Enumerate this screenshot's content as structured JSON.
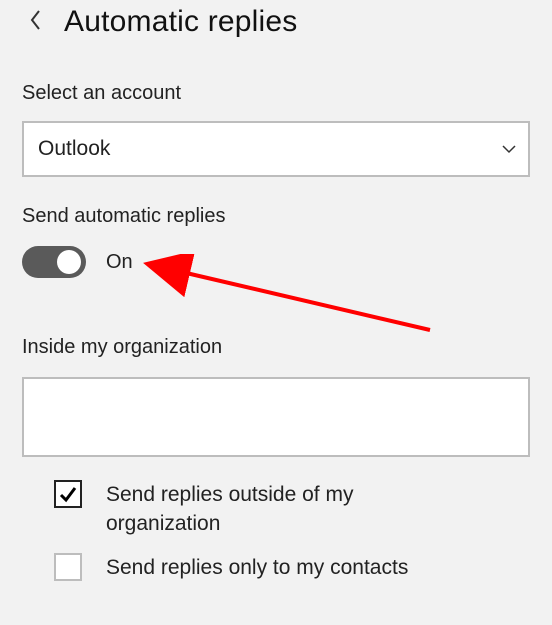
{
  "header": {
    "title": "Automatic replies"
  },
  "account": {
    "label": "Select an account",
    "selected": "Outlook"
  },
  "autoReply": {
    "label": "Send automatic replies",
    "state": "On"
  },
  "inside": {
    "label": "Inside my organization",
    "message": ""
  },
  "outside": {
    "enabled_label": "Send replies outside of my organization",
    "contacts_only_label": "Send replies only to my contacts"
  }
}
